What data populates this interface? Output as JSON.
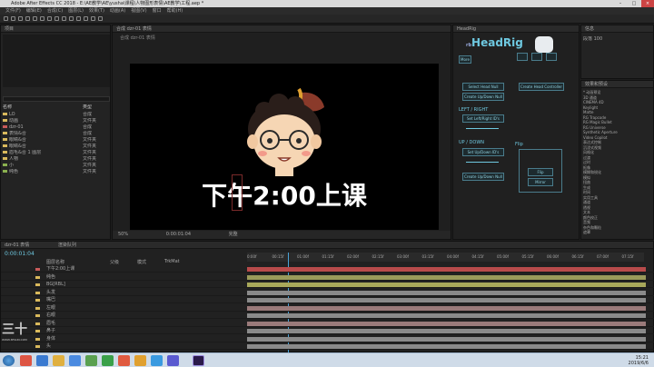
{
  "window_title": "Adobe After Effects CC 2018 - E:\\AE教学\\AE\\yusha\\课程\\人物图形表情\\AE教学\\工程.aep *",
  "menu": [
    "文件(F)",
    "编辑(E)",
    "合成(C)",
    "图层(L)",
    "效果(T)",
    "动画(A)",
    "视图(V)",
    "窗口",
    "帮助(H)"
  ],
  "project": {
    "tab": "项目",
    "items": [
      {
        "name": "LO",
        "color": "#d9b95c",
        "type": "合成"
      },
      {
        "name": "动画",
        "color": "#d9b95c",
        "type": "文件夹"
      },
      {
        "name": "dzr-01",
        "color": "#c85a5a",
        "type": "合成"
      },
      {
        "name": "表情&合",
        "color": "#d9b95c",
        "type": "合成"
      },
      {
        "name": "眼睛&合",
        "color": "#d9b95c",
        "type": "文件夹"
      },
      {
        "name": "眼睛&合",
        "color": "#d9b95c",
        "type": "文件夹"
      },
      {
        "name": "眉毛&合 1 图层",
        "color": "#d9b95c",
        "type": "文件夹"
      },
      {
        "name": "人物",
        "color": "#d9b95c",
        "type": "文件夹"
      },
      {
        "name": "小",
        "color": "#8ab04f",
        "type": "文件夹"
      },
      {
        "name": "纯色",
        "color": "#8ab04f",
        "type": "文件夹"
      }
    ],
    "header_name": "名称",
    "header_type": "类型"
  },
  "composition": {
    "tab": "合成 dzr-01 表情",
    "breadcrumb": "合成 dzr-01 表情",
    "caption": "下午2:00上课",
    "zoom": "50%",
    "timecode": "0:00:01:04",
    "quality": "完整"
  },
  "headrig": {
    "title": "HeadRig",
    "brand_prefix": "rb",
    "left_right": "LEFT / RIGHT",
    "up_down": "UP / DOWN",
    "btn_select": "Select Head Null",
    "btn_create": "Create Head Controller",
    "btn_lr": "Set Left/Right ID's",
    "btn_ud": "Set Up/Down ID's",
    "btn_reset": "Create Up/Down Null",
    "flip_label": "Flip",
    "flip_btn": "Flip",
    "mirror": "Mirror",
    "more": "More"
  },
  "effects": {
    "tab": "效果和预设",
    "items": [
      "* 动画预设",
      "3D 通道",
      "CINEMA 4D",
      "Keylight",
      "Matte",
      "RG Trapcode",
      "RG Magic Bullet",
      "RG Universe",
      "Synthetic Aperture",
      "Video Copilot",
      "表达式控制",
      "沉浸式视频",
      "风格化",
      "过渡",
      "过时",
      "抠像",
      "模糊和锐化",
      "模拟",
      "扭曲",
      "生成",
      "时间",
      "实用工具",
      "通道",
      "透视",
      "文本",
      "颜色校正",
      "音频",
      "杂色和颗粒",
      "遮罩"
    ]
  },
  "info": {
    "tab": "信息",
    "label": "段落",
    "value": "100"
  },
  "timeline": {
    "tab": "dzr-01 表情",
    "render": "渲染队列",
    "timecode": "0:00:01:04",
    "cols": [
      "图层名称",
      "父级",
      "模式",
      "TrkMat"
    ],
    "layers": [
      {
        "name": "下午2:00上课",
        "color": "#c85a5a",
        "bar": "#b84b4b"
      },
      {
        "name": "纯色",
        "color": "#d9b95c",
        "bar": "#9a9a5a"
      },
      {
        "name": "BG[RBL]",
        "color": "#d9b95c",
        "bar": "#a8a85a"
      },
      {
        "name": "头发",
        "color": "#d9b95c",
        "bar": "#8a8a8a"
      },
      {
        "name": "嘴巴",
        "color": "#d9b95c",
        "bar": "#8a8a8a"
      },
      {
        "name": "左眼",
        "color": "#d9b95c",
        "bar": "#9a7a7a"
      },
      {
        "name": "右眼",
        "color": "#d9b95c",
        "bar": "#8a8a8a"
      },
      {
        "name": "眉毛",
        "color": "#d9b95c",
        "bar": "#9a7a7a"
      },
      {
        "name": "鼻子",
        "color": "#d9b95c",
        "bar": "#8a8a8a"
      },
      {
        "name": "身体",
        "color": "#d9b95c",
        "bar": "#8a8a8a"
      },
      {
        "name": "头",
        "color": "#d9b95c",
        "bar": "#8a8a8a"
      }
    ],
    "ruler": [
      "0:00f",
      "00:15f",
      "01:00f",
      "01:15f",
      "02:00f",
      "02:15f",
      "03:00f",
      "03:15f",
      "04:00f",
      "04:15f",
      "05:00f",
      "05:15f",
      "06:00f",
      "06:15f",
      "07:00f",
      "07:15f"
    ]
  },
  "watermark": {
    "logo": "三十",
    "sub": "WWW.3ESUN.COM"
  },
  "taskbar": {
    "time": "15:21",
    "date": "2019/6/6"
  }
}
